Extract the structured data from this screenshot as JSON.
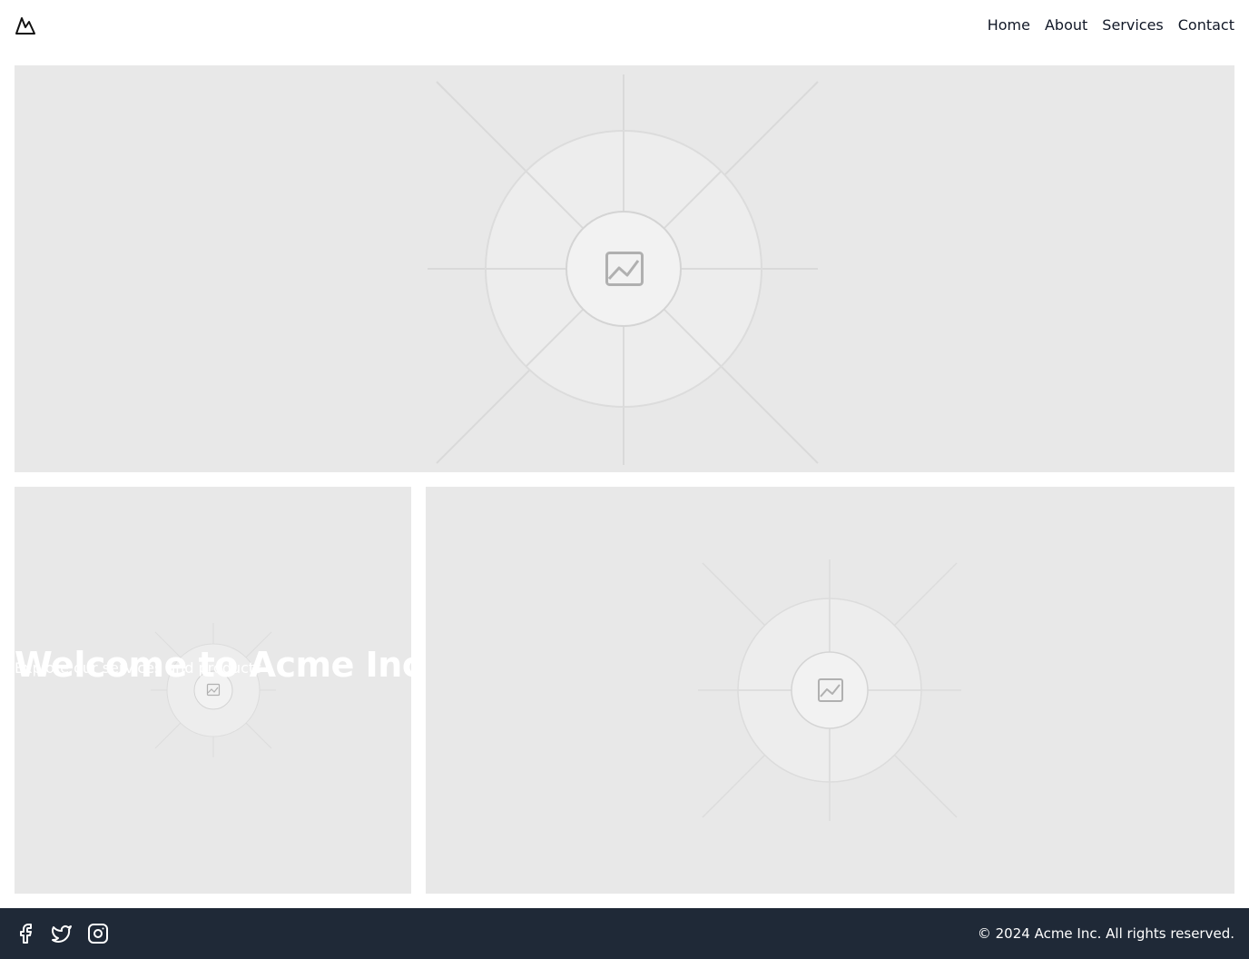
{
  "header": {
    "logo_icon": "mountain-icon",
    "nav": [
      {
        "label": "Home"
      },
      {
        "label": "About"
      },
      {
        "label": "Services"
      },
      {
        "label": "Contact"
      }
    ]
  },
  "hero": {
    "image_icon": "image-placeholder-icon"
  },
  "cards": {
    "left": {
      "title": "Welcome to Acme Inc",
      "subtitle": "Explore our services and products",
      "image_icon": "image-placeholder-icon"
    },
    "right": {
      "image_icon": "image-placeholder-icon"
    }
  },
  "footer": {
    "social": [
      {
        "icon": "facebook-icon"
      },
      {
        "icon": "twitter-icon"
      },
      {
        "icon": "instagram-icon"
      }
    ],
    "copyright": "© 2024 Acme Inc. All rights reserved."
  },
  "colors": {
    "placeholder_bg": "#e8e8e8",
    "footer_bg": "#1f2937",
    "text": "#111827"
  }
}
